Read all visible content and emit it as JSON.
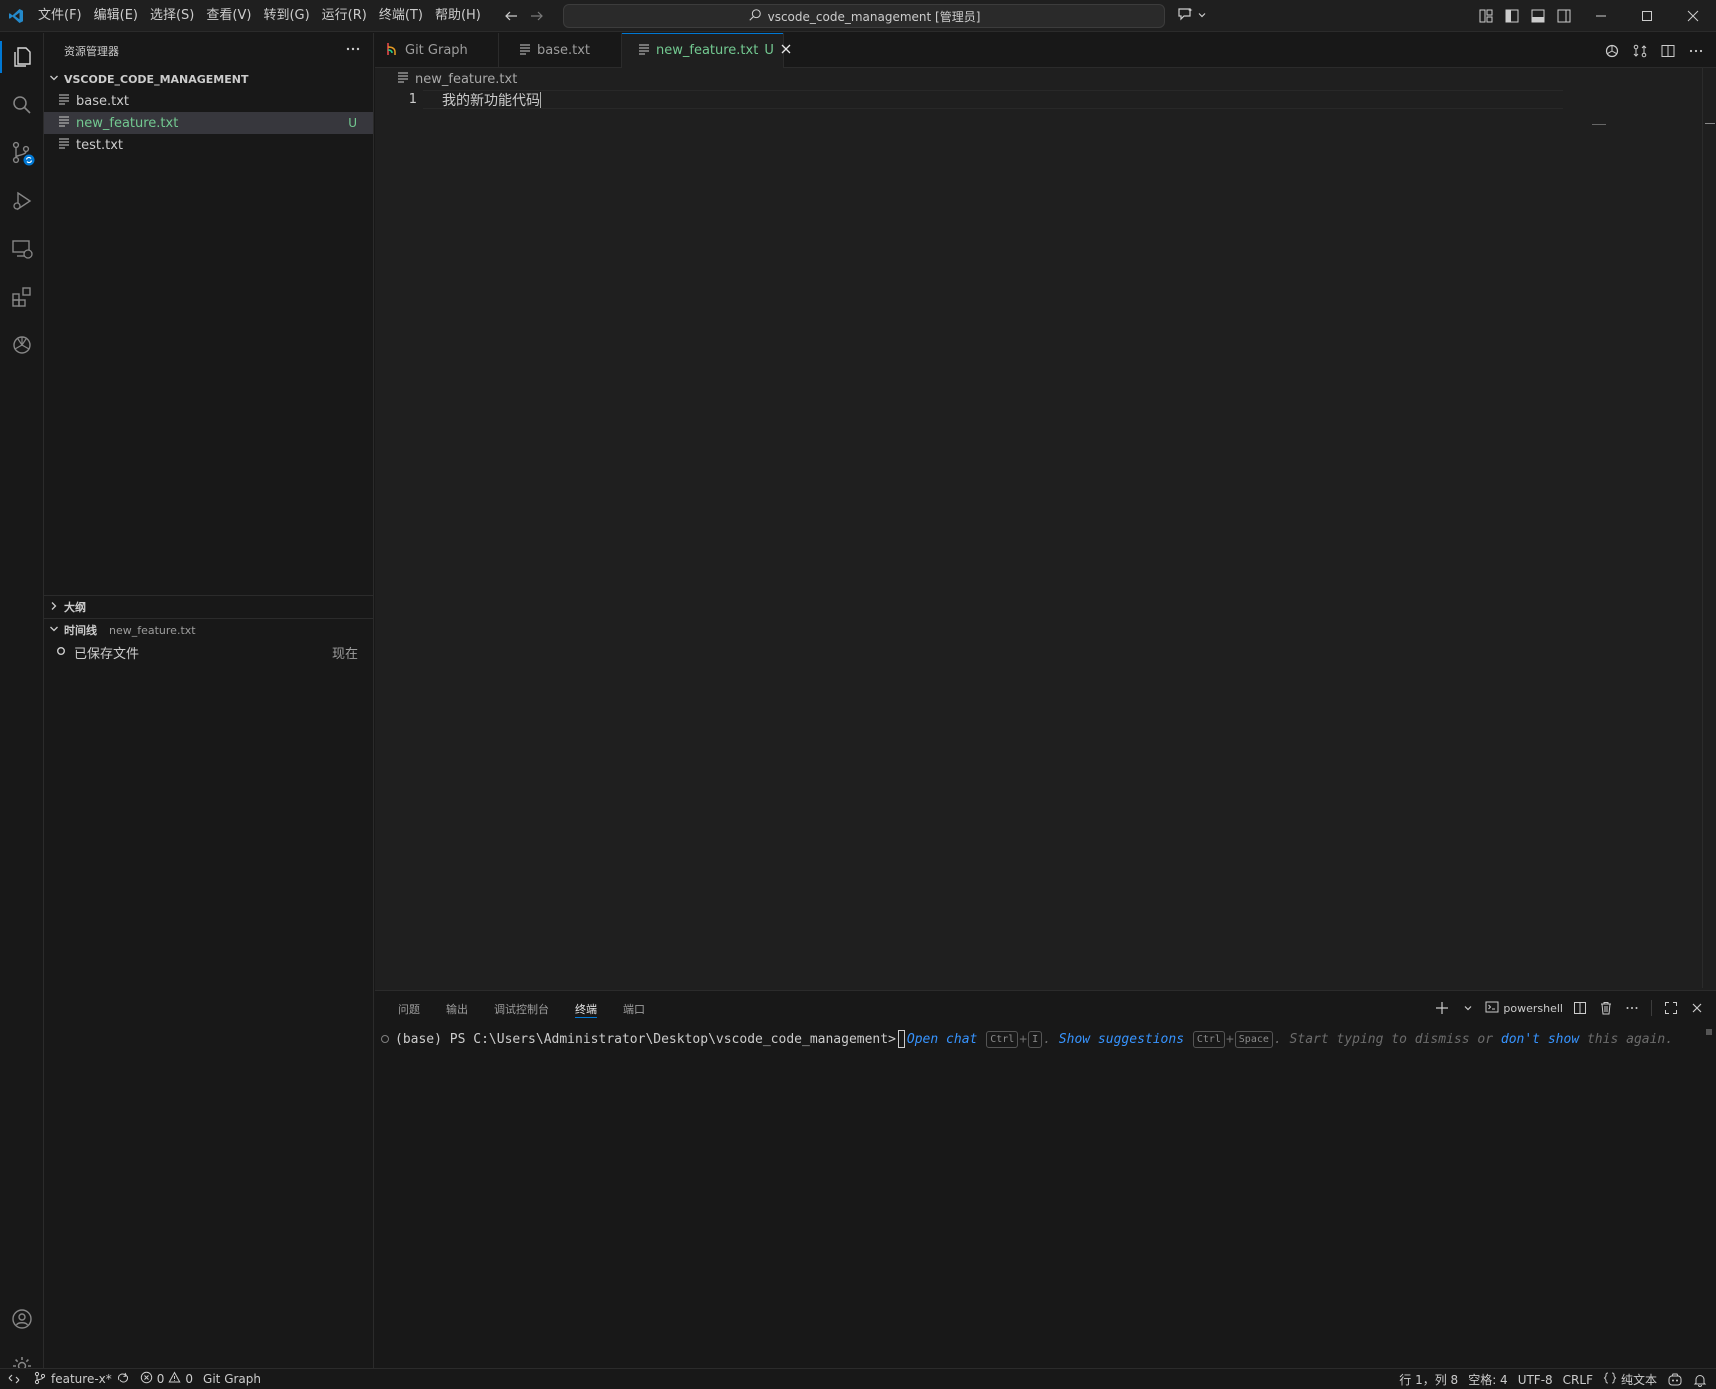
{
  "titlebar": {
    "menu": [
      "文件(F)",
      "编辑(E)",
      "选择(S)",
      "查看(V)",
      "转到(G)",
      "运行(R)",
      "终端(T)",
      "帮助(H)"
    ],
    "command_center": "vscode_code_management [管理员]"
  },
  "sidebar": {
    "title": "资源管理器",
    "project_name": "VSCODE_CODE_MANAGEMENT",
    "files": [
      {
        "name": "base.txt",
        "status": ""
      },
      {
        "name": "new_feature.txt",
        "status": "U"
      },
      {
        "name": "test.txt",
        "status": ""
      }
    ],
    "outline_label": "大纲",
    "timeline_label": "时间线",
    "timeline_file": "new_feature.txt",
    "timeline_items": [
      {
        "label": "已保存文件",
        "time": "现在"
      }
    ]
  },
  "editor": {
    "tabs": [
      {
        "label": "Git Graph",
        "status": ""
      },
      {
        "label": "base.txt",
        "status": ""
      },
      {
        "label": "new_feature.txt",
        "status": "U"
      }
    ],
    "active_tab": 2,
    "breadcrumb": "new_feature.txt",
    "lines": [
      {
        "num": "1",
        "text": "我的新功能代码"
      }
    ]
  },
  "panel": {
    "tabs": [
      "问题",
      "输出",
      "调试控制台",
      "终端",
      "端口"
    ],
    "active_tab": 3,
    "shell_label": "powershell",
    "terminal": {
      "prompt": "(base) PS C:\\Users\\Administrator\\Desktop\\vscode_code_management>",
      "open_chat": "Open chat",
      "kbd_ctrl": "Ctrl",
      "plus": "+",
      "kbd_i": "I",
      "period": ".",
      "show_suggestions": "Show suggestions",
      "kbd_space": "Space",
      "dismiss_text": ". Start typing to dismiss or",
      "dont_show": "don't show",
      "again_text": "this again."
    }
  },
  "statusbar": {
    "branch": "feature-x*",
    "errors": "0",
    "warnings": "0",
    "git_graph": "Git Graph",
    "position": "行 1，列 8",
    "spaces": "空格: 4",
    "encoding": "UTF-8",
    "eol": "CRLF",
    "language": "纯文本"
  },
  "colors": {
    "accent": "#0078d4",
    "untracked": "#73c991",
    "link": "#3794ff"
  }
}
